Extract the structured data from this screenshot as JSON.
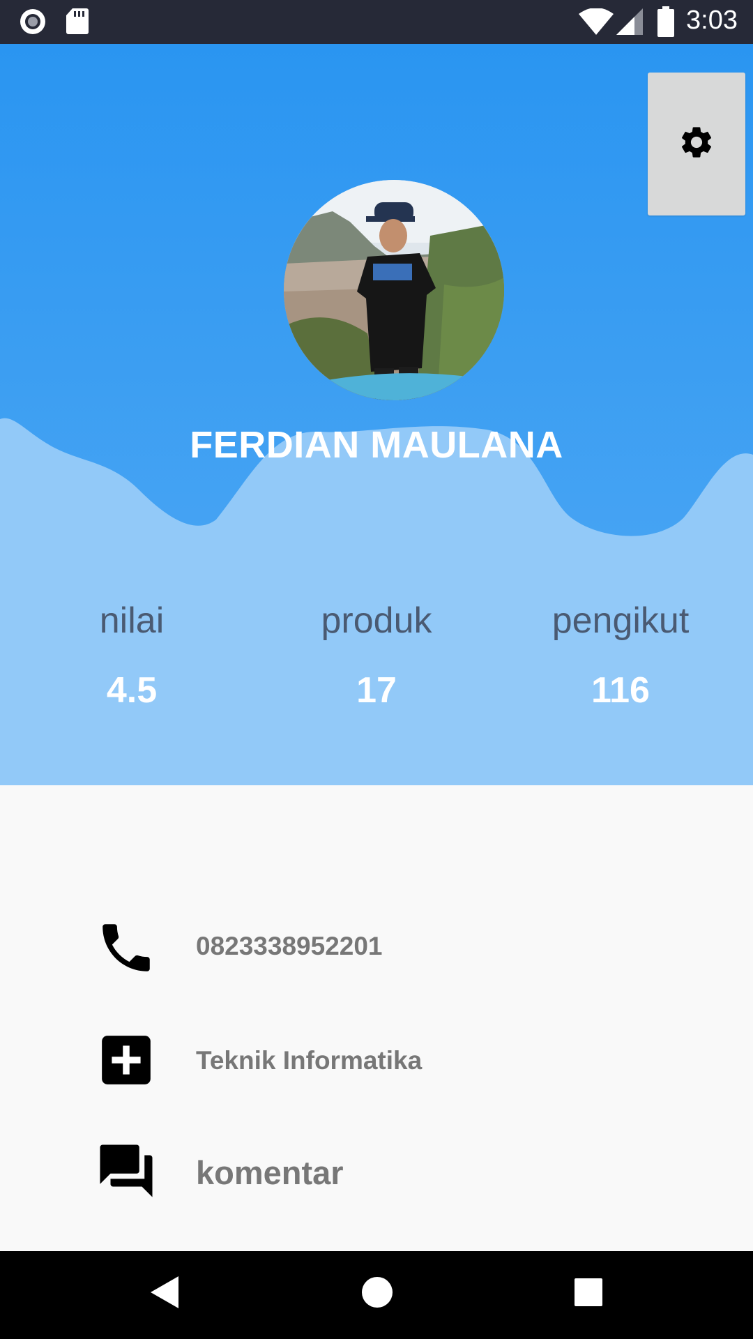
{
  "status_bar": {
    "time": "3:03",
    "icons": [
      "record-icon",
      "sd-card-icon",
      "wifi-icon",
      "signal-icon",
      "battery-icon"
    ]
  },
  "header": {
    "settings_icon": "gear-icon",
    "profile_name": "FERDIAN MAULANA",
    "colors": {
      "top": "#2d97f1",
      "wave_light": "#92c9f8"
    }
  },
  "stats": [
    {
      "label": "nilai",
      "value": "4.5"
    },
    {
      "label": "produk",
      "value": "17"
    },
    {
      "label": "pengikut",
      "value": "116"
    }
  ],
  "info": {
    "phone": "0823338952201",
    "department": "Teknik Informatika",
    "comments": "komentar"
  },
  "nav_bar": {
    "icons": [
      "back-icon",
      "home-icon",
      "recents-icon"
    ]
  }
}
